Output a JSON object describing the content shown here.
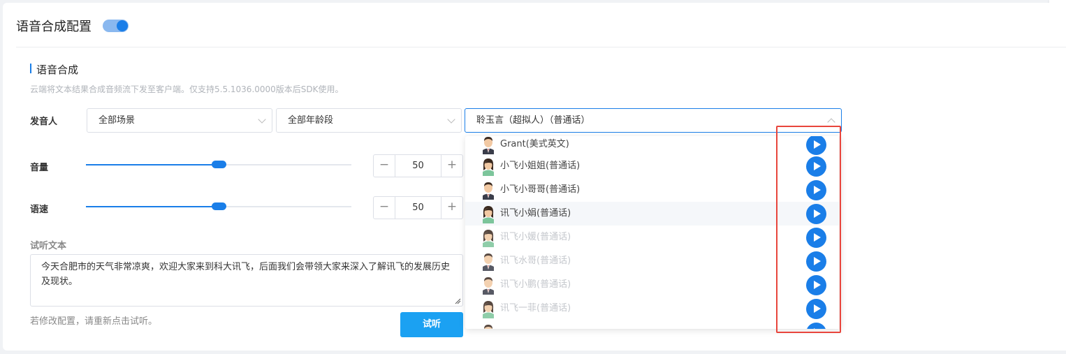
{
  "header": {
    "title": "语音合成配置",
    "toggle_on": true
  },
  "section": {
    "title": "语音合成",
    "description": "云端将文本结果合成音频流下发至客户端。仅支持5.5.1036.0000版本后SDK使用。"
  },
  "speaker": {
    "label": "发音人",
    "scene_select": "全部场景",
    "age_select": "全部年龄段",
    "voice_select": "聆玉言（超拟人）（普通话）"
  },
  "volume": {
    "label": "音量",
    "value": "50",
    "level_percent": 50,
    "minus": "−",
    "plus": "+"
  },
  "speed": {
    "label": "语速",
    "value": "50",
    "level_percent": 50,
    "minus": "−",
    "plus": "+"
  },
  "preview": {
    "label": "试听文本",
    "text": "今天合肥市的天气非常凉爽，欢迎大家来到科大讯飞，后面我们会带领大家来深入了解讯飞的发展历史及现状。",
    "hint": "若修改配置，请重新点击试听。",
    "button": "试听"
  },
  "voice_options": [
    {
      "name": "Grant(美式英文)",
      "gender": "male",
      "faded": false
    },
    {
      "name": "小飞小姐姐(普通话)",
      "gender": "female",
      "faded": false
    },
    {
      "name": "小飞小哥哥(普通话)",
      "gender": "male",
      "faded": false
    },
    {
      "name": "讯飞小娟(普通话)",
      "gender": "female",
      "faded": false
    },
    {
      "name": "讯飞小媛(普通话)",
      "gender": "female",
      "faded": true
    },
    {
      "name": "讯飞水哥(普通话)",
      "gender": "male",
      "faded": true
    },
    {
      "name": "讯飞小鹏(普通话)",
      "gender": "male",
      "faded": true
    },
    {
      "name": "讯飞一菲(普通话)",
      "gender": "female",
      "faded": true
    },
    {
      "name": "",
      "gender": "male",
      "faded": true
    }
  ],
  "colors": {
    "accent": "#1a7ee8",
    "highlight": "#e8453c",
    "button": "#1ba1f2"
  }
}
